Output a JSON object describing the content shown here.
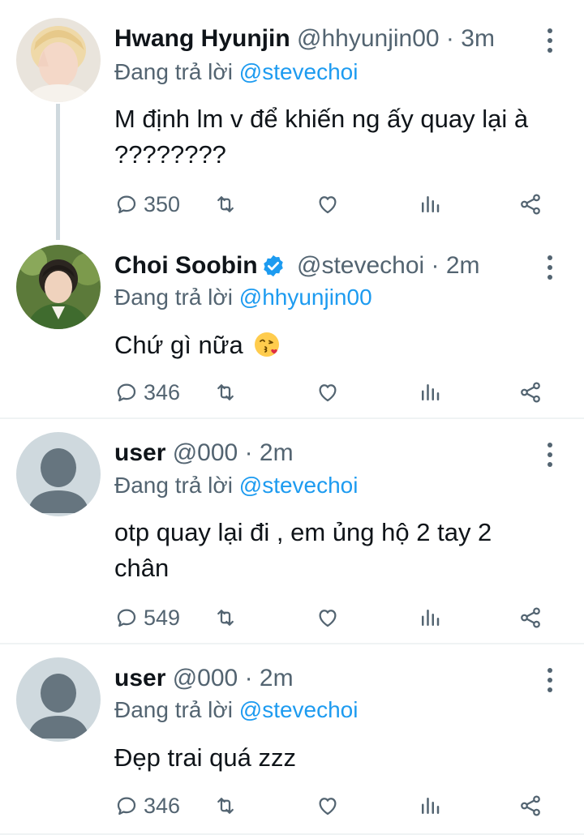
{
  "tweets": [
    {
      "name": "Hwang Hyunjin",
      "handle": "@hhyunjin00",
      "time": "3m",
      "replying_prefix": "Đang trả lời ",
      "replying_to": "@stevechoi",
      "text": "M định lm v để khiến ng ấy quay lại à ????????",
      "replies": "350",
      "verified": false
    },
    {
      "name": "Choi Soobin",
      "handle": "@stevechoi",
      "time": "2m",
      "replying_prefix": "Đang trả lời ",
      "replying_to": "@hhyunjin00",
      "text": "Chứ gì nữa",
      "emoji": "kissing-face-emoji",
      "replies": "346",
      "verified": true
    },
    {
      "name": "user",
      "handle": "@000",
      "time": "2m",
      "replying_prefix": "Đang trả lời ",
      "replying_to": "@stevechoi",
      "text": "otp quay lại đi , em ủng hộ 2 tay 2 chân",
      "replies": "549",
      "verified": false
    },
    {
      "name": "user",
      "handle": "@000",
      "time": "2m",
      "replying_prefix": "Đang trả lời ",
      "replying_to": "@stevechoi",
      "text": "Đẹp trai quá zzz",
      "replies": "346",
      "verified": false
    }
  ],
  "separator": " · ",
  "colors": {
    "accent": "#1d9bf0",
    "muted": "#536471",
    "text": "#0f1419",
    "divider": "#eff3f4"
  },
  "icons": [
    "reply-icon",
    "retweet-icon",
    "like-icon",
    "views-icon",
    "share-icon",
    "more-options-icon",
    "verified-badge-icon"
  ]
}
